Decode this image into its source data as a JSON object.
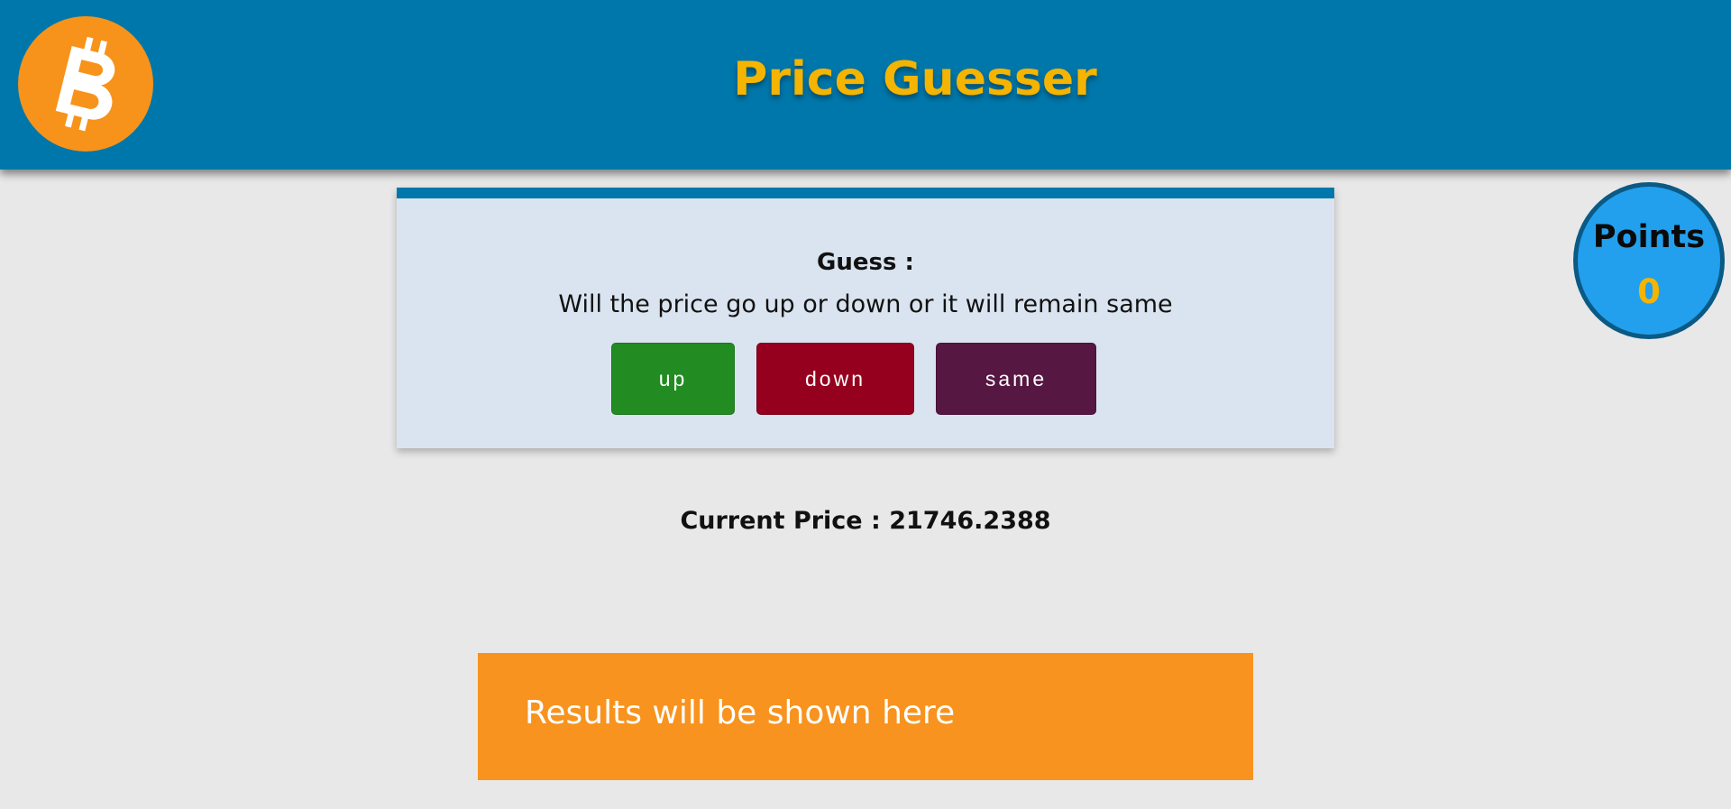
{
  "header": {
    "title": "Price Guesser",
    "logo_icon": "bitcoin-icon",
    "background_color": "#0077aa",
    "title_color": "#f5b400"
  },
  "points": {
    "label": "Points",
    "value": "0"
  },
  "guess": {
    "label": "Guess :",
    "question": "Will the price go up or down or it will remain same",
    "buttons": [
      {
        "label": "up",
        "color": "#228b22"
      },
      {
        "label": "down",
        "color": "#95001e"
      },
      {
        "label": "same",
        "color": "#561742"
      }
    ]
  },
  "price": {
    "text": "Current Price : 21746.2388"
  },
  "results": {
    "text": "Results will be shown here",
    "color": "#f7931e"
  }
}
